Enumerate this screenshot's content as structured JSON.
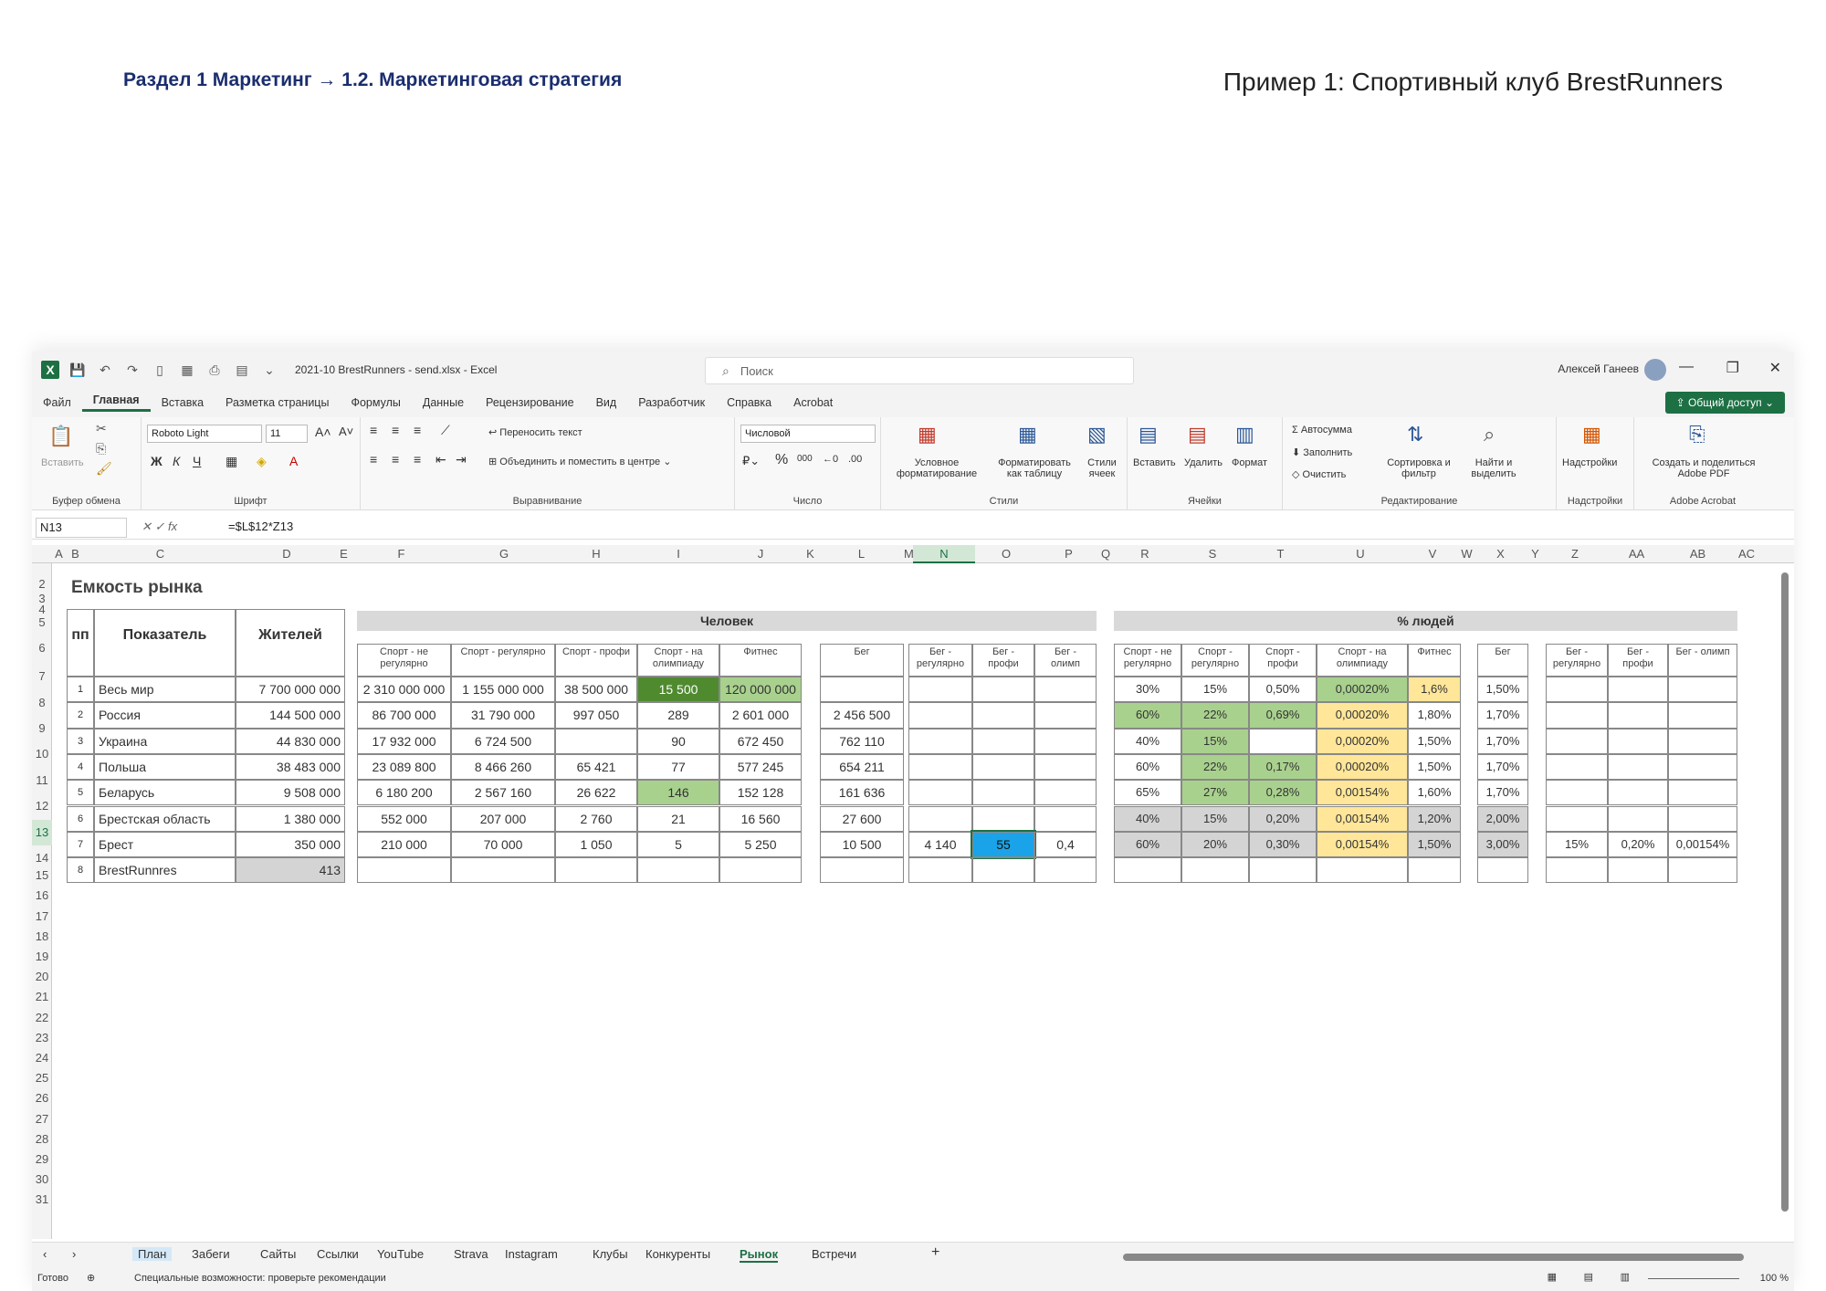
{
  "page": {
    "breadcrumb": "Раздел 1 Маркетинг  → 1.2. Маркетинговая стратегия",
    "example_title": "Пример 1: Спортивный клуб BrestRunners"
  },
  "window": {
    "file_title": "2021-10 BrestRunners - send.xlsx  -  Excel",
    "search_placeholder": "Поиск",
    "user": "Алексей Ганеев",
    "share": "Общий доступ"
  },
  "menu": [
    "Файл",
    "Главная",
    "Вставка",
    "Разметка страницы",
    "Формулы",
    "Данные",
    "Рецензирование",
    "Вид",
    "Разработчик",
    "Справка",
    "Acrobat"
  ],
  "ribbon": {
    "paste": "Вставить",
    "clipboard": "Буфер обмена",
    "font_name": "Roboto Light",
    "font_size": "11",
    "font_group": "Шрифт",
    "wrap_text": "Переносить текст",
    "merge_center": "Объединить и поместить в центре",
    "alignment": "Выравнивание",
    "number_format": "Числовой",
    "number": "Число",
    "cond_format": "Условное форматирование",
    "format_table": "Форматировать как таблицу",
    "cell_styles": "Стили ячеек",
    "styles": "Стили",
    "insert": "Вставить",
    "delete": "Удалить",
    "format": "Формат",
    "cells": "Ячейки",
    "autosum": "Автосумма",
    "fill": "Заполнить",
    "clear": "Очистить",
    "sort_filter": "Сортировка и фильтр",
    "find_select": "Найти и выделить",
    "editing": "Редактирование",
    "addins_btn": "Надстройки",
    "addins": "Надстройки",
    "create_pdf": "Создать и поделиться Adobe PDF",
    "adobe": "Adobe Acrobat"
  },
  "formula_bar": {
    "name_box": "N13",
    "formula": "=$L$12*Z13"
  },
  "columns": [
    "A",
    "B",
    "C",
    "D",
    "E",
    "F",
    "G",
    "H",
    "I",
    "J",
    "K",
    "L",
    "M",
    "N",
    "O",
    "P",
    "Q",
    "R",
    "S",
    "T",
    "U",
    "V",
    "W",
    "X",
    "Y",
    "Z",
    "AA",
    "AB",
    "AC"
  ],
  "rows": [
    "2",
    "3",
    "4",
    "5",
    "6",
    "7",
    "8",
    "9",
    "10",
    "11",
    "12",
    "13",
    "14",
    "15",
    "16",
    "17",
    "18",
    "19",
    "20",
    "21",
    "22",
    "23",
    "24",
    "25",
    "26",
    "27",
    "28",
    "29",
    "30",
    "31"
  ],
  "sheet": {
    "title": "Емкость рынка",
    "band_people": "Человек",
    "band_percent": "% людей",
    "h_nn": "пп",
    "h_indicator": "Показатель",
    "h_residents": "Жителей",
    "h_sport_irreg": "Спорт - не регулярно",
    "h_sport_reg": "Спорт - регулярно",
    "h_sport_pro": "Спорт - профи",
    "h_sport_olymp": "Спорт - на олимпиаду",
    "h_fitness": "Фитнес",
    "h_run": "Бег",
    "h_run_reg": "Бег - регулярно",
    "h_run_pro": "Бег - профи",
    "h_run_olymp": "Бег - олимп",
    "h_run_olymp2": "Бег - олимп",
    "data": [
      [
        "1",
        "Весь мир",
        "7 700 000 000",
        "2 310 000 000",
        "1 155 000 000",
        "38 500 000",
        "15 500",
        "120 000 000",
        "",
        "",
        "",
        "",
        "30%",
        "15%",
        "0,50%",
        "0,00020%",
        "1,6%",
        "1,50%",
        "",
        "",
        ""
      ],
      [
        "2",
        "Россия",
        "144 500 000",
        "86 700 000",
        "31 790 000",
        "997 050",
        "289",
        "2 601 000",
        "2 456 500",
        "",
        "",
        "",
        "60%",
        "22%",
        "0,69%",
        "0,00020%",
        "1,80%",
        "1,70%",
        "",
        "",
        ""
      ],
      [
        "3",
        "Украина",
        "44 830 000",
        "17 932 000",
        "6 724 500",
        "",
        "90",
        "672 450",
        "762 110",
        "",
        "",
        "",
        "40%",
        "15%",
        "",
        "0,00020%",
        "1,50%",
        "1,70%",
        "",
        "",
        ""
      ],
      [
        "4",
        "Польша",
        "38 483 000",
        "23 089 800",
        "8 466 260",
        "65 421",
        "77",
        "577 245",
        "654 211",
        "",
        "",
        "",
        "60%",
        "22%",
        "0,17%",
        "0,00020%",
        "1,50%",
        "1,70%",
        "",
        "",
        ""
      ],
      [
        "5",
        "Беларусь",
        "9 508 000",
        "6 180 200",
        "2 567 160",
        "26 622",
        "146",
        "152 128",
        "161 636",
        "",
        "",
        "",
        "65%",
        "27%",
        "0,28%",
        "0,00154%",
        "1,60%",
        "1,70%",
        "",
        "",
        ""
      ],
      [
        "6",
        "Брестская область",
        "1 380 000",
        "552 000",
        "207 000",
        "2 760",
        "21",
        "16 560",
        "27 600",
        "",
        "",
        "",
        "40%",
        "15%",
        "0,20%",
        "0,00154%",
        "1,20%",
        "2,00%",
        "",
        "",
        ""
      ],
      [
        "7",
        "Брест",
        "350 000",
        "210 000",
        "70 000",
        "1 050",
        "5",
        "5 250",
        "10 500",
        "4 140",
        "55",
        "0,4",
        "60%",
        "20%",
        "0,30%",
        "0,00154%",
        "1,50%",
        "3,00%",
        "15%",
        "0,20%",
        "0,00154%"
      ],
      [
        "8",
        "BrestRunnres",
        "413",
        "",
        "",
        "",
        "",
        "",
        "",
        "",
        "",
        "",
        "",
        "",
        "",
        "",
        "",
        "",
        "",
        "",
        ""
      ]
    ]
  },
  "sheet_tabs": [
    "План",
    "Забеги",
    "Сайты",
    "Ссылки",
    "YouTube",
    "Strava",
    "Instagram",
    "Клубы",
    "Конкуренты",
    "Рынок",
    "Встречи"
  ],
  "status": {
    "ready": "Готово",
    "accessibility": "Специальные возможности: проверьте рекомендации",
    "zoom": "100 %"
  },
  "colors": {
    "excel_green": "#1d7044",
    "dark_green": "#4f8a2f",
    "light_green": "#a9d18e",
    "yellow": "#ffe699",
    "selected_blue": "#1aa3e8"
  }
}
